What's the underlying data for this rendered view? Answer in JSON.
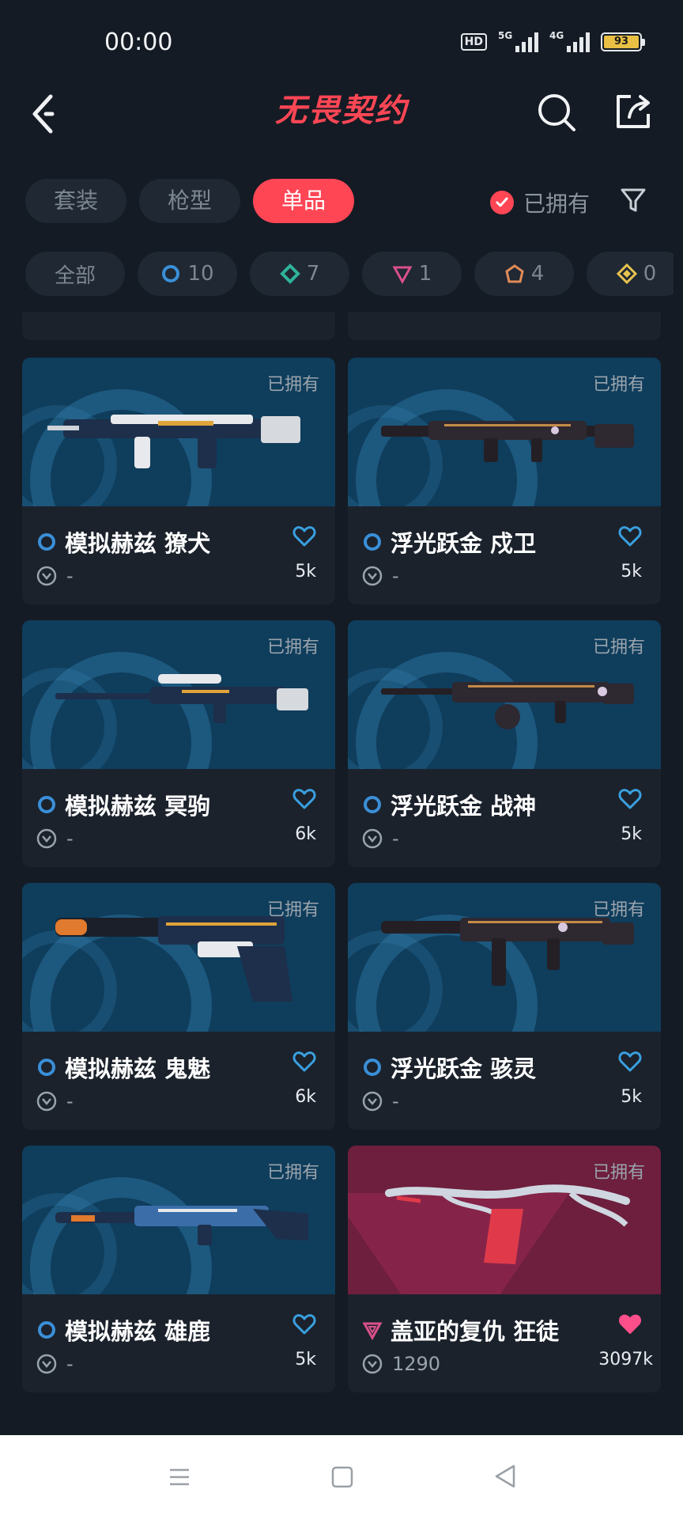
{
  "status_bar": {
    "time": "00:00",
    "hd": "HD",
    "sig1": "5G",
    "sig2": "4G",
    "battery": "93"
  },
  "header": {
    "title": "无畏契约"
  },
  "tabs": [
    {
      "label": "套装",
      "active": false
    },
    {
      "label": "枪型",
      "active": false
    },
    {
      "label": "单品",
      "active": true
    }
  ],
  "owned_filter": {
    "label": "已拥有",
    "checked": true
  },
  "tier_chips": [
    {
      "label": "全部"
    },
    {
      "icon": "select-tier-icon",
      "count": "10",
      "color": "#3a8fd8"
    },
    {
      "icon": "deluxe-tier-icon",
      "count": "7",
      "color": "#2fb39a"
    },
    {
      "icon": "premium-tier-icon",
      "count": "1",
      "color": "#d9508a"
    },
    {
      "icon": "exclusive-tier-icon",
      "count": "4",
      "color": "#e08b57"
    },
    {
      "icon": "ultra-tier-icon",
      "count": "0",
      "color": "#e7c34f"
    }
  ],
  "cards": [
    {
      "owned": "已拥有",
      "name": "模拟赫兹 獠犬",
      "price": "-",
      "likes": "5k",
      "liked": false,
      "tier": "select-tier-icon",
      "bg": "blue"
    },
    {
      "owned": "已拥有",
      "name": "浮光跃金 戍卫",
      "price": "-",
      "likes": "5k",
      "liked": false,
      "tier": "select-tier-icon",
      "bg": "blue"
    },
    {
      "owned": "已拥有",
      "name": "模拟赫兹 冥驹",
      "price": "-",
      "likes": "6k",
      "liked": false,
      "tier": "select-tier-icon",
      "bg": "blue"
    },
    {
      "owned": "已拥有",
      "name": "浮光跃金 战神",
      "price": "-",
      "likes": "5k",
      "liked": false,
      "tier": "select-tier-icon",
      "bg": "blue"
    },
    {
      "owned": "已拥有",
      "name": "模拟赫兹 鬼魅",
      "price": "-",
      "likes": "6k",
      "liked": false,
      "tier": "select-tier-icon",
      "bg": "blue"
    },
    {
      "owned": "已拥有",
      "name": "浮光跃金 骇灵",
      "price": "-",
      "likes": "5k",
      "liked": false,
      "tier": "select-tier-icon",
      "bg": "blue"
    },
    {
      "owned": "已拥有",
      "name": "模拟赫兹 雄鹿",
      "price": "-",
      "likes": "5k",
      "liked": false,
      "tier": "select-tier-icon",
      "bg": "blue"
    },
    {
      "owned": "已拥有",
      "name": "盖亚的复仇 狂徒",
      "price": "1290",
      "likes": "3097k",
      "liked": true,
      "tier": "premium-tier-icon",
      "bg": "gaia"
    }
  ],
  "colors": {
    "accent": "#ff4655",
    "background": "#141b24",
    "card": "#1b222c",
    "heart_outline": "#3aa0e0",
    "heart_filled": "#ff4f8b"
  }
}
